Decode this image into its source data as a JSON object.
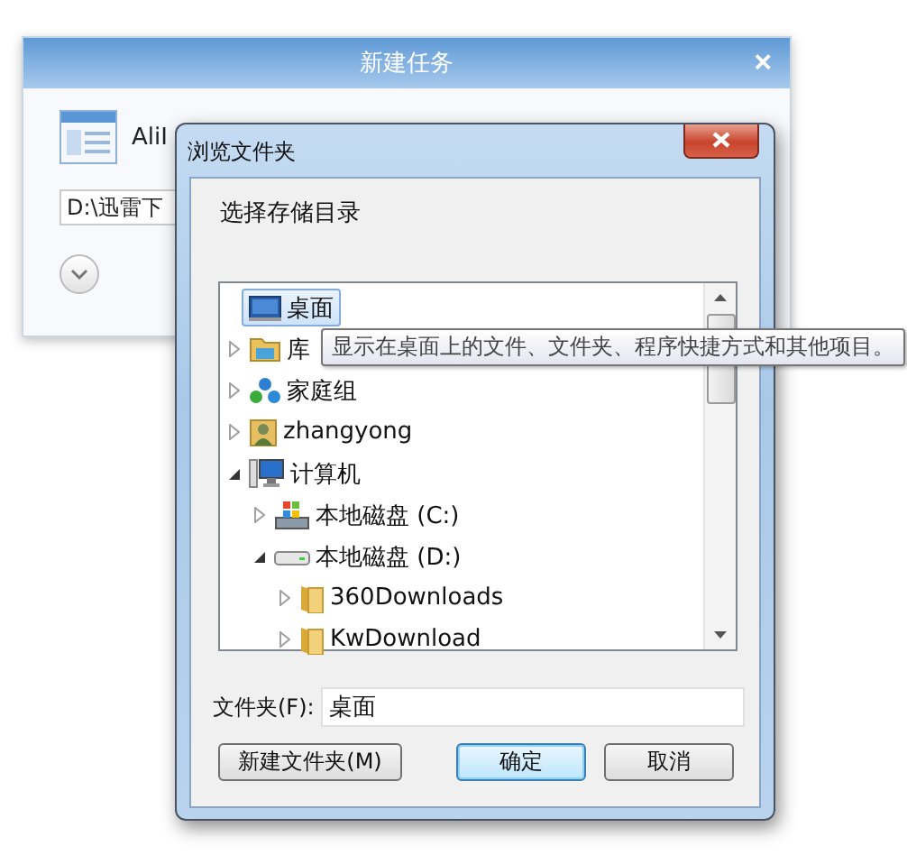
{
  "back_window": {
    "title": "新建任务",
    "close": "×",
    "task_name": "AliI",
    "path_field": "D:\\迅雷下"
  },
  "dialog": {
    "title": "浏览文件夹",
    "prompt": "选择存储目录",
    "tree": [
      {
        "label": "桌面",
        "kind": "desktop",
        "selected": true
      },
      {
        "label": "库",
        "kind": "library",
        "selected": false,
        "expanded": false
      },
      {
        "label": "家庭组",
        "kind": "homegroup",
        "selected": false,
        "expanded": false
      },
      {
        "label": "zhangyong",
        "kind": "user",
        "selected": false,
        "expanded": false
      },
      {
        "label": "计算机",
        "kind": "computer",
        "selected": false,
        "expanded": true,
        "children": [
          {
            "label": "本地磁盘 (C:)",
            "kind": "system-drive",
            "selected": false,
            "expanded": false
          },
          {
            "label": "本地磁盘 (D:)",
            "kind": "drive",
            "selected": false,
            "expanded": true,
            "children": [
              {
                "label": "360Downloads",
                "kind": "folder",
                "selected": false,
                "expanded": false
              },
              {
                "label": "KwDownload",
                "kind": "folder",
                "selected": false,
                "expanded": false
              }
            ]
          }
        ]
      }
    ],
    "tooltip": "显示在桌面上的文件、文件夹、程序快捷方式和其他项目。",
    "folder_label": "文件夹(F):",
    "folder_value": "桌面",
    "buttons": [
      {
        "label": "新建文件夹(M)",
        "kind": "normal"
      },
      {
        "label": "确定",
        "kind": "default"
      },
      {
        "label": "取消",
        "kind": "normal"
      }
    ]
  }
}
